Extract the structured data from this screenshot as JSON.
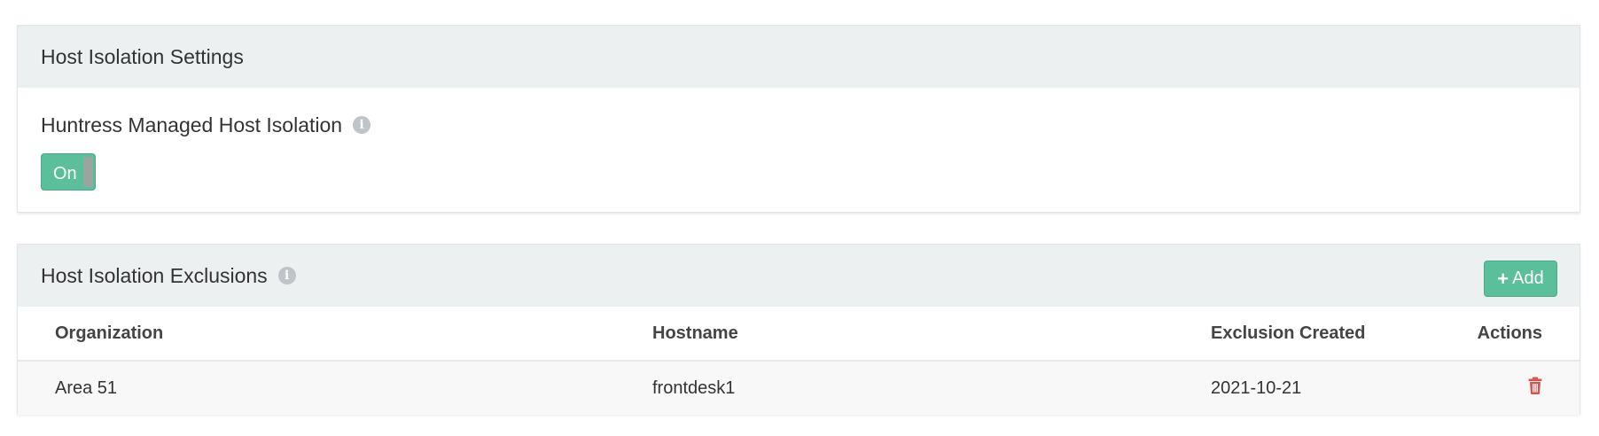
{
  "settings": {
    "title": "Host Isolation Settings",
    "setting_label": "Huntress Managed Host Isolation",
    "info_icon": "info-circle-icon",
    "toggle": {
      "label": "On",
      "state": true
    }
  },
  "exclusions": {
    "title": "Host Isolation Exclusions",
    "info_icon": "info-circle-icon",
    "add_button": {
      "icon": "plus-icon",
      "label": "Add"
    },
    "columns": [
      "Organization",
      "Hostname",
      "Exclusion Created",
      "Actions"
    ],
    "rows": [
      {
        "organization": "Area 51",
        "hostname": "frontdesk1",
        "created": "2021-10-21",
        "action_icon": "trash-icon"
      }
    ]
  },
  "colors": {
    "accent": "#5cbf9b",
    "danger": "#d9534f",
    "heading_bg": "#edf0f1"
  }
}
